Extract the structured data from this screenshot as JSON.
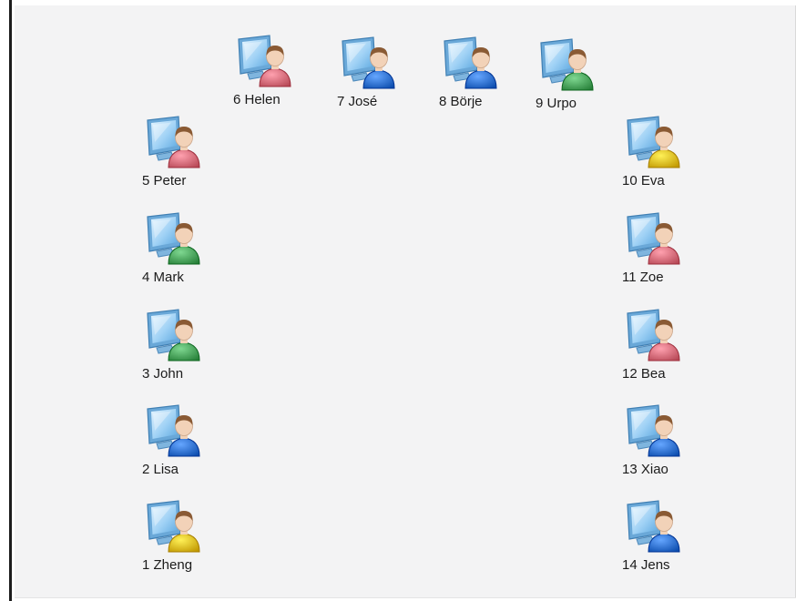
{
  "workstations": [
    {
      "label": "1 Zheng",
      "shirt": "#e3ba20"
    },
    {
      "label": "2 Lisa",
      "shirt": "#2e6fd0"
    },
    {
      "label": "3 John",
      "shirt": "#48a15a"
    },
    {
      "label": "4 Mark",
      "shirt": "#48a15a"
    },
    {
      "label": "5 Peter",
      "shirt": "#d96a78"
    },
    {
      "label": "6 Helen",
      "shirt": "#d96a78"
    },
    {
      "label": "7 José",
      "shirt": "#2e6fd0"
    },
    {
      "label": "8 Börje",
      "shirt": "#2e6fd0"
    },
    {
      "label": "9 Urpo",
      "shirt": "#48a15a"
    },
    {
      "label": "10 Eva",
      "shirt": "#e3ba20"
    },
    {
      "label": "11 Zoe",
      "shirt": "#d96a78"
    },
    {
      "label": "12 Bea",
      "shirt": "#d96a78"
    },
    {
      "label": "13 Xiao",
      "shirt": "#2e6fd0"
    },
    {
      "label": "14 Jens",
      "shirt": "#2e6fd0"
    }
  ],
  "icon_name": "user-at-computer-icon",
  "colors": {
    "background": "#f3f3f4",
    "label_text": "#1b1b1b",
    "monitor": "#9fd1f5",
    "hair": "#8a5a34",
    "skin": "#f2d2b8"
  }
}
